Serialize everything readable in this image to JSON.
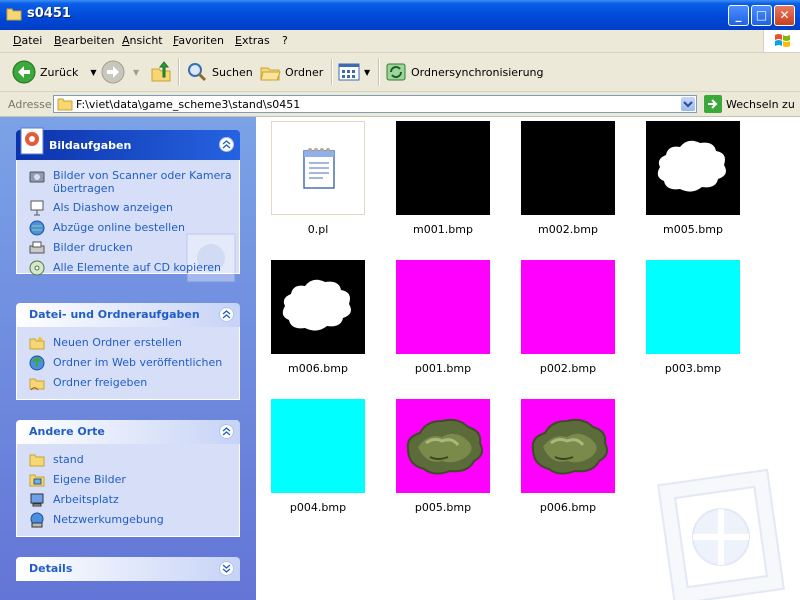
{
  "window": {
    "title": "s0451"
  },
  "menu": [
    "Datei",
    "Bearbeiten",
    "Ansicht",
    "Favoriten",
    "Extras",
    "?"
  ],
  "toolbar": {
    "back": "Zurück",
    "search": "Suchen",
    "folders": "Ordner",
    "sync": "Ordnersynchronisierung"
  },
  "address": {
    "label": "Adresse",
    "path": "F:\\viet\\data\\game_scheme3\\stand\\s0451",
    "go": "Wechseln zu"
  },
  "panels": {
    "picture_tasks": {
      "title": "Bildaufgaben",
      "items": [
        "Bilder von Scanner oder Kamera übertragen",
        "Als Diashow anzeigen",
        "Abzüge online bestellen",
        "Bilder drucken",
        "Alle Elemente auf CD kopieren"
      ]
    },
    "file_tasks": {
      "title": "Datei- und Ordneraufgaben",
      "items": [
        "Neuen Ordner erstellen",
        "Ordner im Web veröffentlichen",
        "Ordner freigeben"
      ]
    },
    "other_places": {
      "title": "Andere Orte",
      "items": [
        "stand",
        "Eigene Bilder",
        "Arbeitsplatz",
        "Netzwerkumgebung"
      ]
    },
    "details": {
      "title": "Details"
    }
  },
  "files": [
    {
      "name": "0.pl",
      "kind": "document",
      "color": "#ffffff"
    },
    {
      "name": "m001.bmp",
      "kind": "black",
      "color": "#000000"
    },
    {
      "name": "m002.bmp",
      "kind": "black",
      "color": "#000000"
    },
    {
      "name": "m005.bmp",
      "kind": "mask",
      "color": "#000000"
    },
    {
      "name": "m006.bmp",
      "kind": "mask",
      "color": "#000000"
    },
    {
      "name": "p001.bmp",
      "kind": "solid",
      "color": "#ff00ff"
    },
    {
      "name": "p002.bmp",
      "kind": "solid",
      "color": "#ff00ff"
    },
    {
      "name": "p003.bmp",
      "kind": "solid",
      "color": "#00ffff"
    },
    {
      "name": "p004.bmp",
      "kind": "solid",
      "color": "#00ffff"
    },
    {
      "name": "p005.bmp",
      "kind": "terrain",
      "color": "#ff00ff"
    },
    {
      "name": "p006.bmp",
      "kind": "terrain",
      "color": "#ff00ff"
    }
  ]
}
